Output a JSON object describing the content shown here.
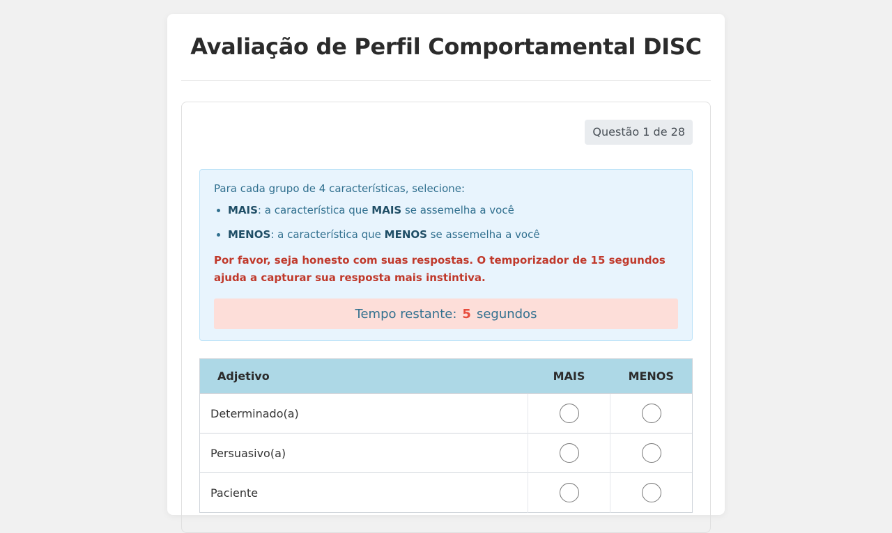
{
  "page": {
    "title": "Avaliação de Perfil Comportamental DISC"
  },
  "question": {
    "counter": "Questão 1 de 28"
  },
  "instructions": {
    "intro": "Para cada grupo de 4 características, selecione:",
    "mais": {
      "key": "MAIS",
      "pre": ": a característica que ",
      "emph": "MAIS",
      "post": " se assemelha a você"
    },
    "menos": {
      "key": "MENOS",
      "pre": ": a característica que ",
      "emph": "MENOS",
      "post": " se assemelha a você"
    },
    "warning": "Por favor, seja honesto com suas respostas. O temporizador de 15 segundos ajuda a capturar sua resposta mais instintiva."
  },
  "timer": {
    "label": "Tempo restante:",
    "value": "5",
    "unit": "segundos"
  },
  "table": {
    "headers": {
      "adjective": "Adjetivo",
      "mais": "MAIS",
      "menos": "MENOS"
    },
    "rows": [
      {
        "label": "Determinado(a)"
      },
      {
        "label": "Persuasivo(a)"
      },
      {
        "label": "Paciente"
      }
    ]
  }
}
